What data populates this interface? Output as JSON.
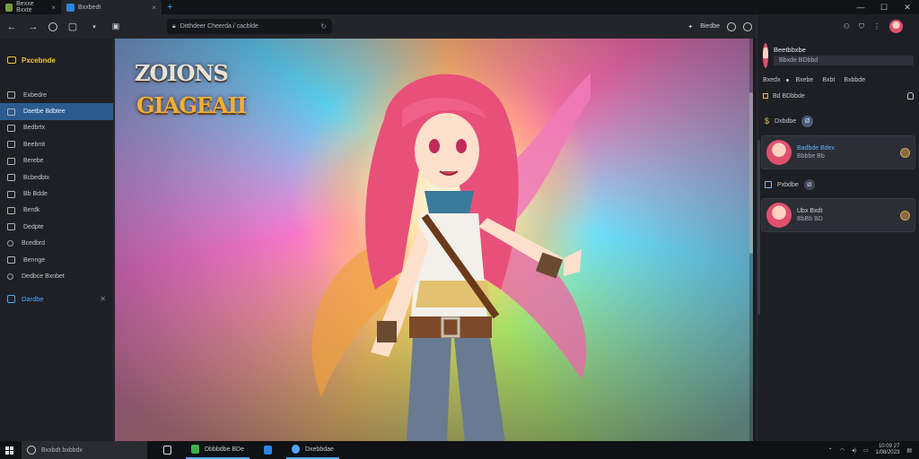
{
  "titlebar": {
    "tabs": [
      {
        "label": "Bexxe Bxxte",
        "active": false
      },
      {
        "label": "Bxxbedt",
        "active": true
      }
    ],
    "new_tab_symbol": "+",
    "window_controls": [
      "—",
      "☐",
      "✕"
    ]
  },
  "navbar": {
    "back": "←",
    "forward": "→",
    "address": "Ditthdeer Cheerda / cacblde",
    "right_label": "Biedbe",
    "icons": [
      "circle-icon",
      "box-icon",
      "chevron-down-icon",
      "panel-icon"
    ]
  },
  "sidebar": {
    "header": "Pxcebnde",
    "items": [
      {
        "label": "Exbedre",
        "selected": false
      },
      {
        "label": "Daetbe Bdbtee",
        "selected": true
      },
      {
        "label": "Bedbrtx",
        "selected": false
      },
      {
        "label": "Beebmt",
        "selected": false
      },
      {
        "label": "Berebe",
        "selected": false
      },
      {
        "label": "Bcbedbtx",
        "selected": false
      },
      {
        "label": "Bb Bdde",
        "selected": false
      },
      {
        "label": "Berdk",
        "selected": false
      },
      {
        "label": "Dedpte",
        "selected": false
      },
      {
        "label": "Bcedbrd",
        "selected": false
      },
      {
        "label": "Bennge",
        "selected": false
      },
      {
        "label": "Dedbce Bxnbet",
        "selected": false
      }
    ],
    "footer": "Dardbe",
    "footer_close": "✕"
  },
  "content": {
    "logo_line1": "ZOIONS",
    "logo_line2": "GIAGEAII"
  },
  "right_panel": {
    "profile": {
      "name": "Beetbbxbe",
      "status": "Bbxde  BDbbd"
    },
    "tabs": [
      "Bxedx",
      "Bxebe",
      "Bxbt",
      "Bxbbde"
    ],
    "stat": "Bd BDbbde",
    "section1": {
      "label": "Dxbdbe",
      "badge": "Ø"
    },
    "card1": {
      "name": "Badbde Bdex",
      "sub": "Bbbbe  Bb"
    },
    "section2": {
      "label": "Pxbdbe",
      "badge": "Ø"
    },
    "card2": {
      "name": "Ubx Bxdt",
      "sub": "BbBb  BD"
    }
  },
  "taskbar": {
    "search_text": "Bxxbdt bxbbdx",
    "apps": [
      {
        "label": "",
        "color": "#dfe3ea"
      },
      {
        "label": "Dbbbdbe BDe",
        "color": "#3bb04a"
      },
      {
        "label": "",
        "color": "#2d86e0"
      },
      {
        "label": "Dxebbdae",
        "color": "#4fa8ff"
      }
    ],
    "clock_time": "10:09 27",
    "clock_date": "1/08/2023"
  }
}
